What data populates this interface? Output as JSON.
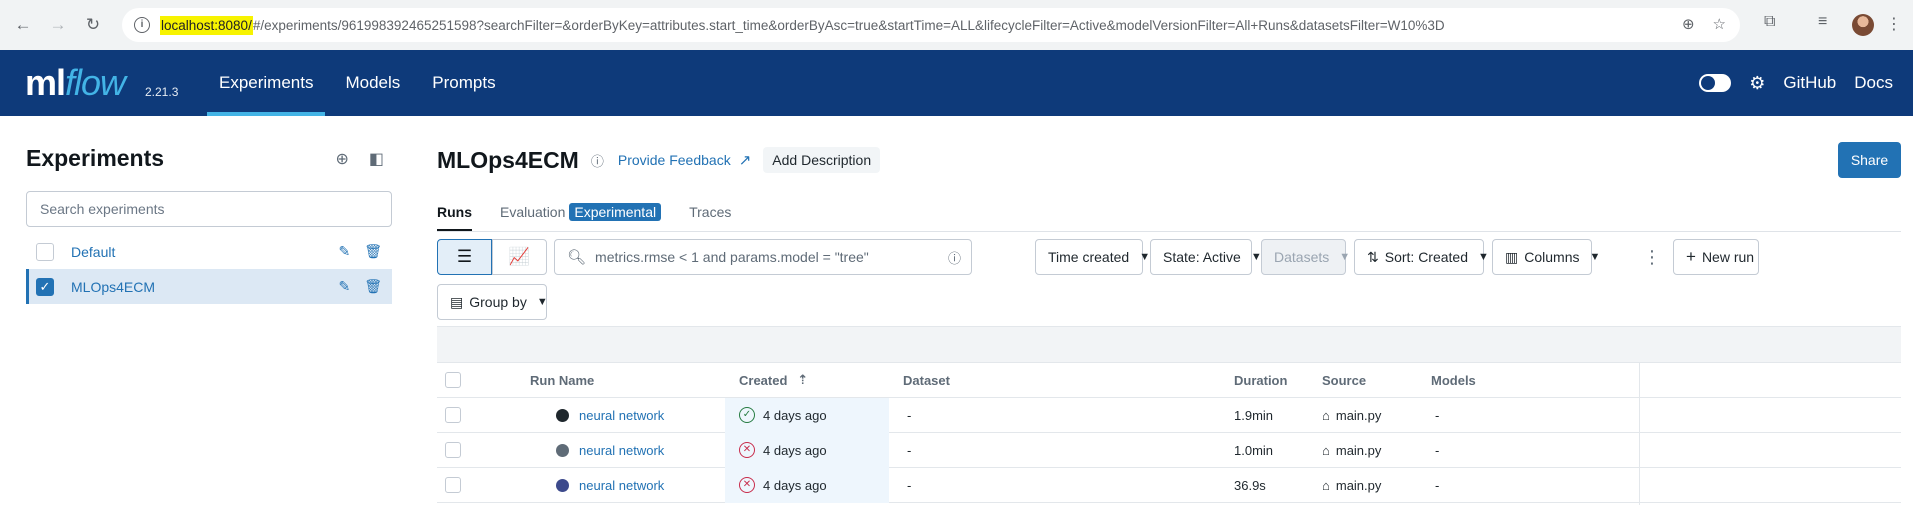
{
  "browser": {
    "url_host": "localhost:8080/",
    "url_rest": "#/experiments/961998392465251598?searchFilter=&orderByKey=attributes.start_time&orderByAsc=true&startTime=ALL&lifecycleFilter=Active&modelVersionFilter=All+Runs&datasetsFilter=W10%3D"
  },
  "header": {
    "logo_ml": "ml",
    "logo_flow": "flow",
    "version": "2.21.3",
    "nav": [
      "Experiments",
      "Models",
      "Prompts"
    ],
    "github": "GitHub",
    "docs": "Docs"
  },
  "sidebar": {
    "title": "Experiments",
    "search_placeholder": "Search experiments",
    "items": [
      {
        "name": "Default",
        "checked": false
      },
      {
        "name": "MLOps4ECM",
        "checked": true
      }
    ]
  },
  "main": {
    "title": "MLOps4ECM",
    "feedback": "Provide Feedback",
    "add_description": "Add Description",
    "share": "Share",
    "tabs": [
      "Runs",
      "Evaluation",
      "Experimental",
      "Traces"
    ],
    "search_placeholder": "metrics.rmse < 1 and params.model = \"tree\"",
    "time_created": "Time created",
    "state": "State: Active",
    "datasets": "Datasets",
    "sort": "Sort: Created",
    "columns": "Columns",
    "new_run": "New run",
    "group_by": "Group by"
  },
  "table": {
    "headers": [
      "Run Name",
      "Created",
      "Dataset",
      "Duration",
      "Source",
      "Models"
    ],
    "rows": [
      {
        "name": "neural network",
        "color": "#1f272d",
        "status": "ok",
        "created": "4 days ago",
        "dataset": "-",
        "duration": "1.9min",
        "source": "main.py",
        "models": "-"
      },
      {
        "name": "neural network",
        "color": "#5f6b77",
        "status": "failed",
        "created": "4 days ago",
        "dataset": "-",
        "duration": "1.0min",
        "source": "main.py",
        "models": "-"
      },
      {
        "name": "neural network",
        "color": "#3d4a8c",
        "status": "failed",
        "created": "4 days ago",
        "dataset": "-",
        "duration": "36.9s",
        "source": "main.py",
        "models": "-"
      }
    ]
  }
}
